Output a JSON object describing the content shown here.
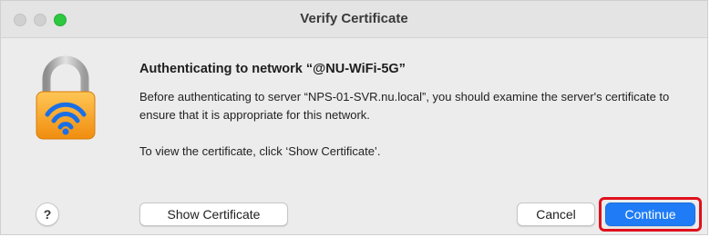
{
  "window": {
    "title": "Verify Certificate"
  },
  "dialog": {
    "headline": "Authenticating to network “@NU-WiFi-5G”",
    "body": "Before authenticating to server “NPS-01-SVR.nu.local”, you should examine the server's certificate to ensure that it is appropriate for this network.",
    "instruction": "To view the certificate, click ‘Show Certificate’.",
    "icon": "lock-wifi-icon"
  },
  "buttons": {
    "help_label": "?",
    "show_certificate_label": "Show Certificate",
    "cancel_label": "Cancel",
    "continue_label": "Continue"
  },
  "colors": {
    "accent": "#1f7cf6",
    "highlight": "#e0101c",
    "lock_body": "#f5a623",
    "lock_shackle": "#b8b8b8"
  }
}
